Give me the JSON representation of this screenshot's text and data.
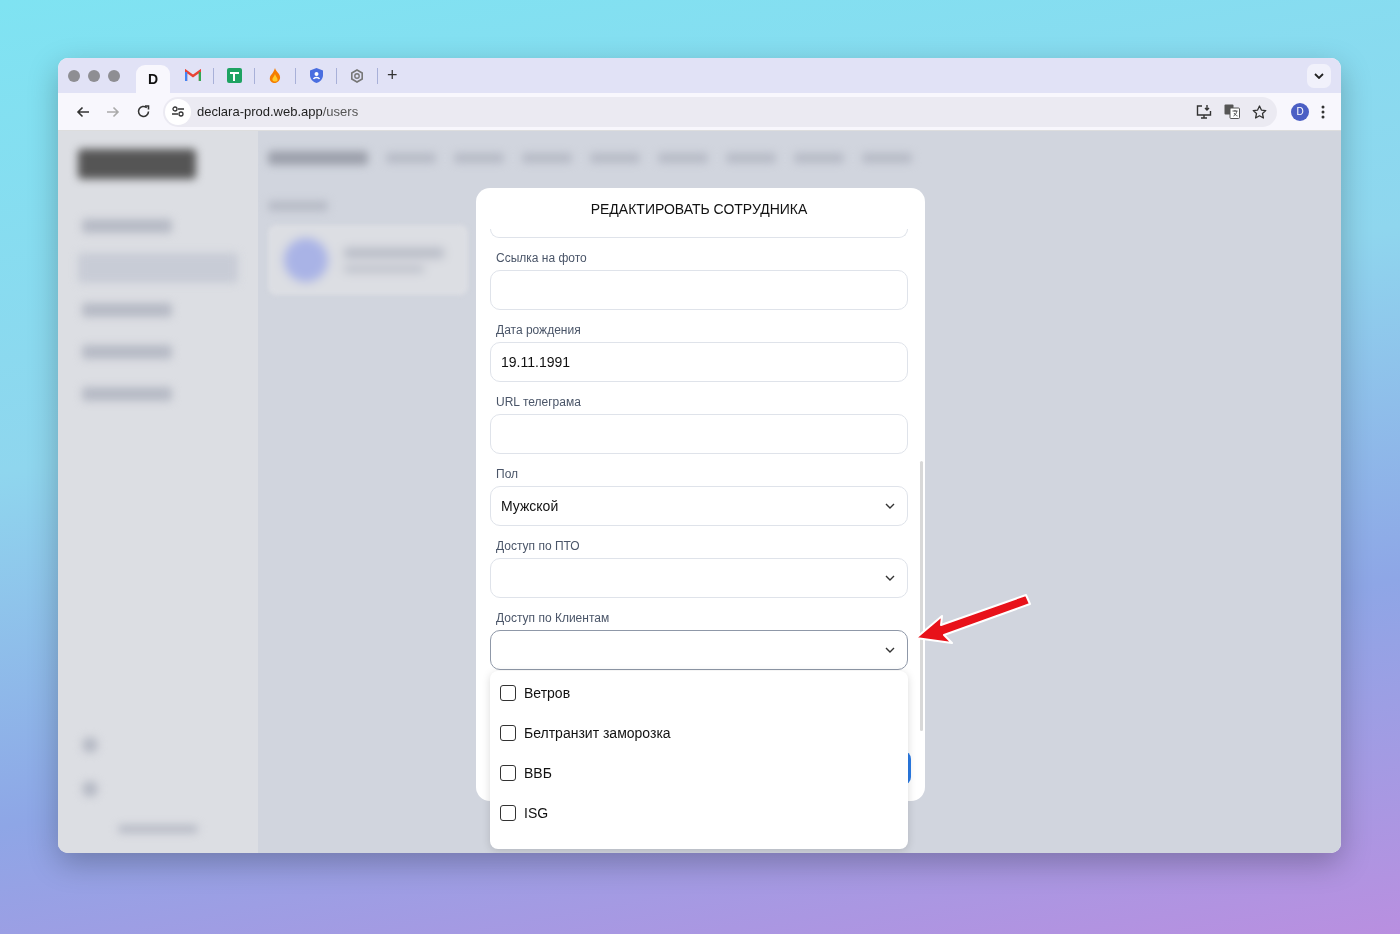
{
  "browser": {
    "tabs": [
      {
        "kind": "logo",
        "glyph": "D",
        "selected": true
      },
      {
        "kind": "mail",
        "selected": false
      },
      {
        "kind": "sheet",
        "selected": false
      },
      {
        "kind": "flame",
        "selected": false
      },
      {
        "kind": "shield",
        "selected": false
      },
      {
        "kind": "gear",
        "selected": false
      }
    ],
    "new_tab": "+",
    "nav": [
      {
        "kind": "back",
        "disabled": false
      },
      {
        "kind": "forward",
        "disabled": true
      },
      {
        "kind": "reload",
        "disabled": false
      }
    ],
    "address": {
      "host": "declara-prod.web.app",
      "path": "/users"
    },
    "profile": "D"
  },
  "modal": {
    "title": "РЕДАКТИРОВАТЬ СОТРУДНИКА",
    "fields": [
      {
        "kind": "text",
        "label": "Ссылка на фото",
        "focused": false
      },
      {
        "kind": "text",
        "label": "Дата рождения",
        "value": "19.11.1991",
        "focused": false
      },
      {
        "kind": "text",
        "label": "URL телеграма",
        "focused": false
      },
      {
        "kind": "select",
        "label": "Пол",
        "value": "Мужской",
        "focused": false
      },
      {
        "kind": "select",
        "label": "Доступ по ПТО",
        "focused": false
      },
      {
        "kind": "select",
        "label": "Доступ по Клиентам",
        "focused": true
      }
    ],
    "options": [
      {
        "label": "Ветров",
        "checked": false
      },
      {
        "label": "Белтранзит заморозка",
        "checked": false
      },
      {
        "label": "ВВБ",
        "checked": false
      },
      {
        "label": "ISG",
        "checked": false
      }
    ]
  }
}
